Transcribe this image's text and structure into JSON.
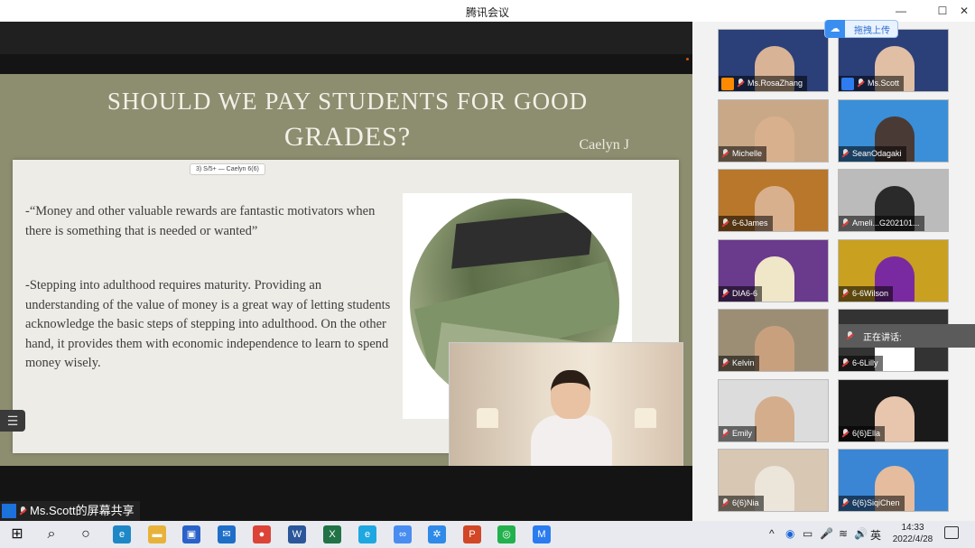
{
  "window": {
    "title": "腾讯会议",
    "minimize": "—",
    "maximize": "☐",
    "close": "✕"
  },
  "upload_button": {
    "label": "拖拽上传"
  },
  "slide": {
    "title_line1": "SHOULD WE PAY STUDENTS FOR GOOD",
    "title_line2": "GRADES?",
    "author": "Caelyn J",
    "tag": "3) S/5+ — Caelyn 6(6)",
    "bullet1": "-“Money and other valuable rewards are fantastic motivators when there is something that is needed or wanted”",
    "bullet2": "-Stepping into adulthood requires maturity. Providing an understanding of the value of money is a great way of letting students acknowledge the basic steps of stepping into adulthood. On the other hand, it provides them with economic independence to learn to spend money wisely."
  },
  "share_label": "Ms.Scott的屏幕共享",
  "speaking_label": "正在讲话:",
  "participants": [
    {
      "name": "Ms.RosaZhang",
      "color": "#2b3f78",
      "skin": "#d8b396"
    },
    {
      "name": "Ms.Scott",
      "color": "#2b3f78",
      "skin": "#e0bfa5"
    },
    {
      "name": "Michelle",
      "color": "#c8a887",
      "skin": "#d9b08e"
    },
    {
      "name": "SeanOdagaki",
      "color": "#3a8fd8",
      "skin": "#4a3a36"
    },
    {
      "name": "6-6James",
      "color": "#b8772a",
      "skin": "#d9b08e"
    },
    {
      "name": "Ameli...G202101...",
      "color": "#bbbbbb",
      "skin": "#2a2a2a"
    },
    {
      "name": "DIA6-6",
      "color": "#6a3a8c",
      "skin": "#f0e6c8"
    },
    {
      "name": "6-6Wilson",
      "color": "#c9a020",
      "skin": "#7a2aa0"
    },
    {
      "name": "Kelvin",
      "color": "#9c8e75",
      "skin": "#c9a07e"
    },
    {
      "name": "6-6Lilly",
      "color": "#333333",
      "skin": "#ffffff"
    },
    {
      "name": "Emily",
      "color": "#dcdcdc",
      "skin": "#d4ad8c"
    },
    {
      "name": "6(6)Ella",
      "color": "#1a1a1a",
      "skin": "#e7c6ad"
    },
    {
      "name": "6(6)Nia",
      "color": "#d8c7b3",
      "skin": "#ece5da"
    },
    {
      "name": "6(6)SiqiChen",
      "color": "#3a86d4",
      "skin": "#e5bc9e"
    }
  ],
  "taskbar": {
    "icons": [
      "windows-start",
      "search",
      "task-view",
      "edge",
      "file-explorer",
      "store",
      "mail",
      "chrome",
      "word",
      "excel",
      "ie",
      "baidu-netdisk",
      "tencent-video",
      "powerpoint",
      "wechat",
      "tencent-meeting"
    ],
    "ime": "英",
    "time": "14:33",
    "date": "2022/4/28"
  }
}
